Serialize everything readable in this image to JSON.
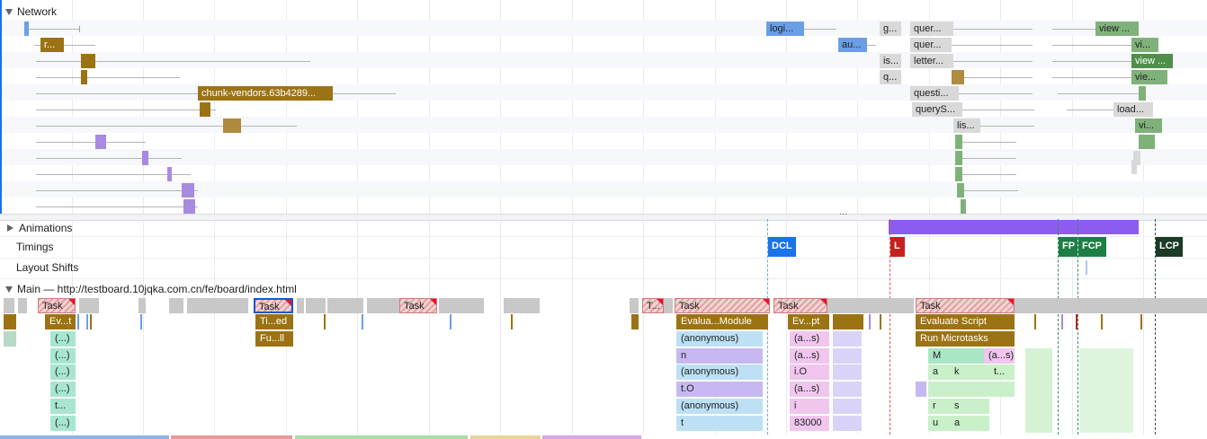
{
  "sections": {
    "network": "Network",
    "animations": "Animations",
    "timings": "Timings",
    "layout_shifts": "Layout Shifts",
    "main": "Main — http://testboard.10jqka.com.cn/fe/board/index.html"
  },
  "network_requests": {
    "r_short": "r...",
    "chunk_vendors": "chunk-vendors.63b4289...",
    "logi": "logi...",
    "au": "au...",
    "g": "g...",
    "quer1": "quer...",
    "quer2": "quer...",
    "is": "is...",
    "letter": "letter...",
    "q": "q...",
    "questi": "questi...",
    "queryS": "queryS...",
    "lis": "lis...",
    "view1": "view ...",
    "vi1": "vi...",
    "view2": "view ...",
    "vie": "vie...",
    "load": "load...",
    "vi2": "vi..."
  },
  "splitter_dots": "...",
  "timings": {
    "dcl": "DCL",
    "l": "L",
    "fp": "FP",
    "fcp": "FCP",
    "lcp": "LCP"
  },
  "colors": {
    "script": "#9c7314",
    "document": "#6a9fe6",
    "image": "#7fb27a",
    "font": "#a78be0",
    "xhr": "#d9d9d9",
    "dcl": "#1a73e8",
    "l": "#c5221f",
    "fp": "#1e7e43",
    "fcp": "#1e7e43",
    "lcp": "#1b3a28",
    "animation": "#8c5cf0"
  },
  "main": {
    "tasks": [
      "Task",
      "Task",
      "Task",
      "T...",
      "Task",
      "Task",
      "Task"
    ],
    "evt": "Ev...t",
    "ellipsis": "(...)",
    "t_dots": "t...",
    "tied": "Ti...ed",
    "full": "Fu...ll",
    "evaluate_module": "Evalua...Module",
    "anonymous": "(anonymous)",
    "n": "n",
    "to": "t.O",
    "t": "t",
    "evpt": "Ev...pt",
    "as": "(a...s)",
    "io": "i.O",
    "i": "i",
    "num": "83000",
    "evaluate_script": "Evaluate Script",
    "run_microtasks": "Run Microtasks",
    "m": "M",
    "a": "a",
    "k": "k",
    "r": "r",
    "s": "s",
    "u": "u"
  }
}
